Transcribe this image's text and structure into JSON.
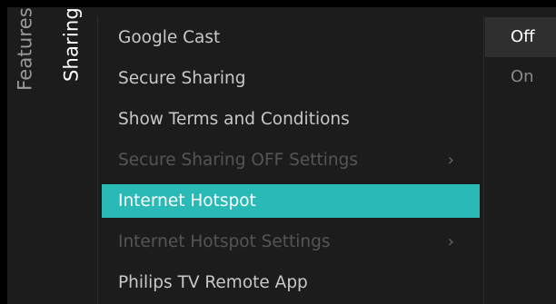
{
  "breadcrumb": {
    "parent": "Features",
    "current": "Sharing"
  },
  "menu": {
    "items": [
      {
        "label": "Google Cast",
        "state": "normal",
        "has_submenu": false
      },
      {
        "label": "Secure Sharing",
        "state": "normal",
        "has_submenu": false
      },
      {
        "label": "Show Terms and Conditions",
        "state": "normal",
        "has_submenu": false
      },
      {
        "label": "Secure Sharing OFF Settings",
        "state": "disabled",
        "has_submenu": true
      },
      {
        "label": "Internet Hotspot",
        "state": "selected",
        "has_submenu": false
      },
      {
        "label": "Internet Hotspot Settings",
        "state": "disabled",
        "has_submenu": true
      },
      {
        "label": "Philips TV Remote App",
        "state": "normal",
        "has_submenu": false
      }
    ],
    "chevron_glyph": "›"
  },
  "options": {
    "items": [
      {
        "label": "Off",
        "active": true
      },
      {
        "label": "On",
        "active": false
      }
    ]
  },
  "colors": {
    "highlight": "#29bab8",
    "panel_background": "#1c1c1c",
    "active_option_background": "#2f2f2f"
  },
  "icons": {
    "submenu": "chevron-right-icon"
  }
}
